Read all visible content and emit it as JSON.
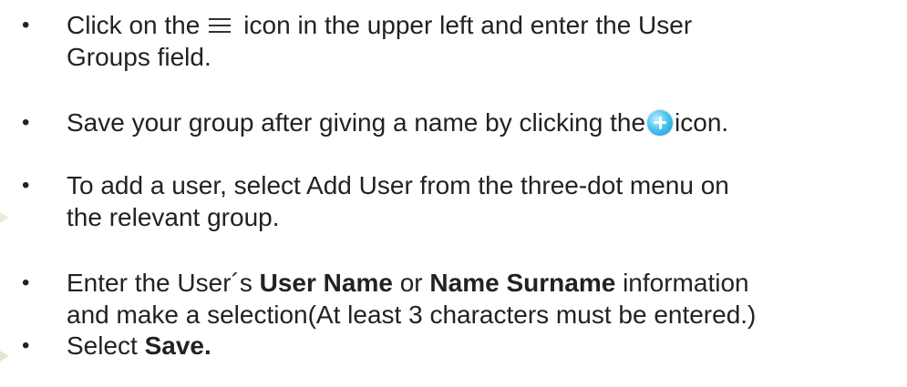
{
  "bullet_symbol": "•",
  "items": [
    {
      "line1_before_icon": "Click on the",
      "icon": "hamburger-menu-icon",
      "line1_after_icon": "icon in the upper left and enter the User",
      "line2": "Groups field."
    },
    {
      "before_icon": "Save your group after giving a name by clicking the",
      "icon": "add-plus-circle-icon",
      "after_icon": "icon."
    },
    {
      "line1": "To add a user, select Add User from the three-dot menu on",
      "line2": "the relevant group."
    },
    {
      "line1_prefix": "Enter the User´s ",
      "bold1": "User Name",
      "middle": " or ",
      "bold2": "Name Surname",
      "line1_suffix": " information",
      "line2": "and make a selection(At least 3 characters must be entered.)"
    },
    {
      "prefix": "Select ",
      "bold": "Save."
    }
  ],
  "colors": {
    "text": "#222222",
    "add_icon": "#2fa8e0",
    "decor_arrow": "#e7ebdd"
  }
}
